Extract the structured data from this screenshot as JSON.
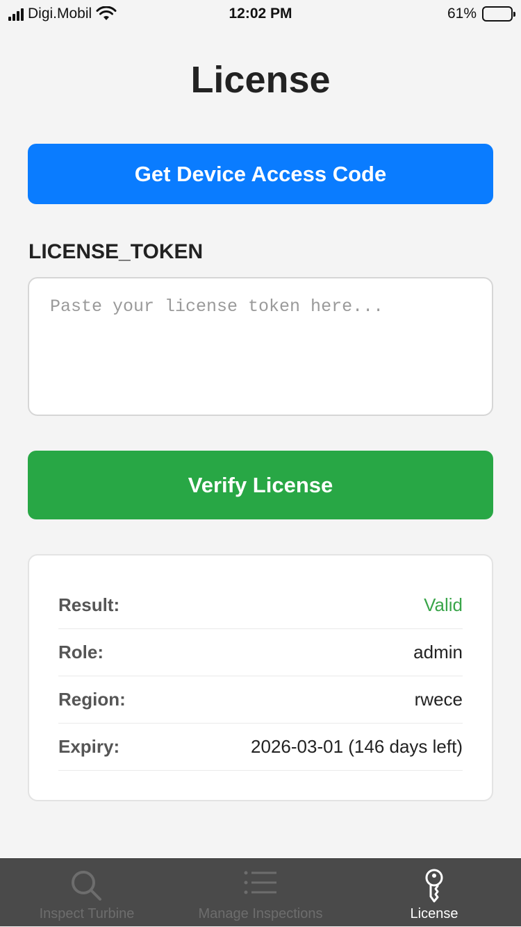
{
  "status_bar": {
    "carrier": "Digi.Mobil",
    "time": "12:02 PM",
    "battery_percent": "61%",
    "battery_level": 0.61
  },
  "page": {
    "title": "License"
  },
  "actions": {
    "access_code_label": "Get Device Access Code",
    "verify_label": "Verify License"
  },
  "token": {
    "label": "LICENSE_TOKEN",
    "placeholder": "Paste your license token here...",
    "value": ""
  },
  "result": {
    "rows": [
      {
        "key": "Result:",
        "value": "Valid"
      },
      {
        "key": "Role:",
        "value": "admin"
      },
      {
        "key": "Region:",
        "value": "rwece"
      },
      {
        "key": "Expiry:",
        "value": "2026-03-01 (146 days left)"
      }
    ]
  },
  "tabs": [
    {
      "label": "Inspect Turbine",
      "icon": "search-icon",
      "active": false
    },
    {
      "label": "Manage Inspections",
      "icon": "list-icon",
      "active": false
    },
    {
      "label": "License",
      "icon": "key-icon",
      "active": true
    }
  ],
  "colors": {
    "primary": "#0a7cff",
    "success": "#28a745",
    "valid_text": "#3aa54a",
    "tab_bar": "#4a4a4a"
  }
}
